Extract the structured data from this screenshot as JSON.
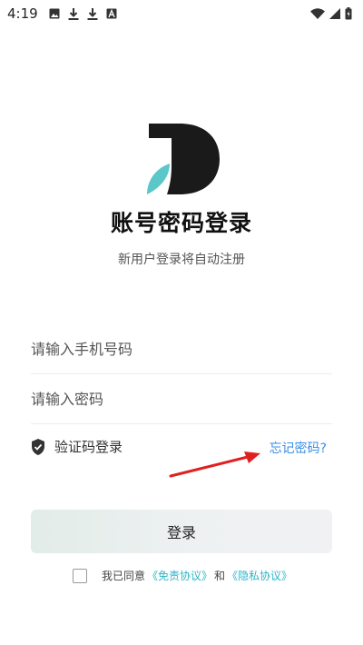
{
  "status_bar": {
    "time": "4:19",
    "left_icons": [
      "image-icon",
      "download-icon",
      "download-icon",
      "font-a-icon"
    ],
    "right_icons": [
      "wifi-icon",
      "signal-icon",
      "battery-icon"
    ]
  },
  "login": {
    "title": "账号密码登录",
    "subtitle": "新用户登录将自动注册",
    "phone_placeholder": "请输入手机号码",
    "password_placeholder": "请输入密码",
    "sms_login_label": "验证码登录",
    "forgot_password": "忘记密码?",
    "submit_label": "登录"
  },
  "agreement": {
    "prefix": "我已同意",
    "terms_link": "《免责协议》",
    "conjunction": "和",
    "privacy_link": "《隐私协议》"
  },
  "colors": {
    "link": "#3a8ee6",
    "agreement_link": "#2fb5c7",
    "annotation_arrow": "#e02020",
    "logo_dark": "#1a1a1a",
    "logo_teal": "#5bc7c9"
  }
}
